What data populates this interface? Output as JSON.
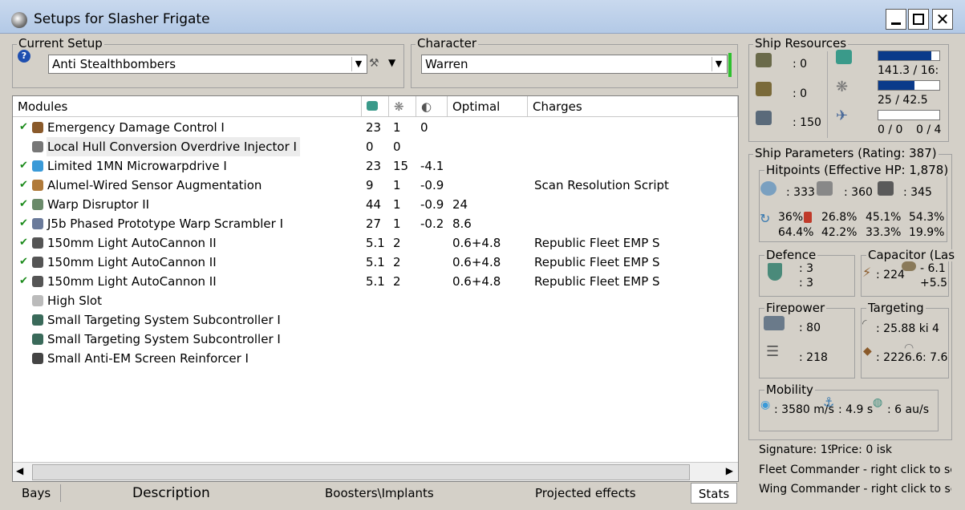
{
  "window": {
    "title": "Setups for Slasher Frigate"
  },
  "current_setup": {
    "legend": "Current Setup",
    "value": "Anti Stealthbombers"
  },
  "character": {
    "legend": "Character",
    "value": "Warren"
  },
  "modules": {
    "headers": [
      "Modules",
      "",
      "",
      "",
      "Optimal",
      "Charges"
    ],
    "rows": [
      {
        "checked": true,
        "name": "Emergency Damage Control I",
        "c1": "23",
        "c2": "1",
        "c3": "0",
        "optimal": "",
        "charges": "",
        "icon_color": "#8a5a2b"
      },
      {
        "checked": false,
        "name": "Local Hull Conversion Overdrive Injector I",
        "c1": "0",
        "c2": "0",
        "c3": "",
        "optimal": "",
        "charges": "",
        "icon_color": "#777777"
      },
      {
        "checked": true,
        "name": "Limited 1MN Microwarpdrive I",
        "c1": "23",
        "c2": "15",
        "c3": "-4.1",
        "optimal": "",
        "charges": "",
        "icon_color": "#3a9ad8"
      },
      {
        "checked": true,
        "name": "Alumel-Wired Sensor Augmentation",
        "c1": "9",
        "c2": "1",
        "c3": "-0.9",
        "optimal": "",
        "charges": "Scan Resolution Script",
        "icon_color": "#b07a3a"
      },
      {
        "checked": true,
        "name": "Warp Disruptor II",
        "c1": "44",
        "c2": "1",
        "c3": "-0.9",
        "optimal": "24",
        "charges": "",
        "icon_color": "#6a8a6a"
      },
      {
        "checked": true,
        "name": "J5b Phased Prototype Warp Scrambler I",
        "c1": "27",
        "c2": "1",
        "c3": "-0.2",
        "optimal": "8.6",
        "charges": "",
        "icon_color": "#6a7a9a"
      },
      {
        "checked": true,
        "name": "150mm Light AutoCannon II",
        "c1": "5.1",
        "c2": "2",
        "c3": "",
        "optimal": "0.6+4.8",
        "charges": "Republic Fleet EMP S",
        "icon_color": "#555555"
      },
      {
        "checked": true,
        "name": "150mm Light AutoCannon II",
        "c1": "5.1",
        "c2": "2",
        "c3": "",
        "optimal": "0.6+4.8",
        "charges": "Republic Fleet EMP S",
        "icon_color": "#555555"
      },
      {
        "checked": true,
        "name": "150mm Light AutoCannon II",
        "c1": "5.1",
        "c2": "2",
        "c3": "",
        "optimal": "0.6+4.8",
        "charges": "Republic Fleet EMP S",
        "icon_color": "#555555"
      },
      {
        "checked": false,
        "name": "High Slot",
        "c1": "",
        "c2": "",
        "c3": "",
        "optimal": "",
        "charges": "",
        "icon_color": "#bbbbbb"
      },
      {
        "checked": false,
        "name": "Small Targeting System Subcontroller I",
        "c1": "",
        "c2": "",
        "c3": "",
        "optimal": "",
        "charges": "",
        "icon_color": "#3a6a5a"
      },
      {
        "checked": false,
        "name": "Small Targeting System Subcontroller I",
        "c1": "",
        "c2": "",
        "c3": "",
        "optimal": "",
        "charges": "",
        "icon_color": "#3a6a5a"
      },
      {
        "checked": false,
        "name": "Small Anti-EM Screen Reinforcer I",
        "c1": "",
        "c2": "",
        "c3": "",
        "optimal": "",
        "charges": "",
        "icon_color": "#444444"
      }
    ]
  },
  "tabs": [
    "Bays",
    "Description",
    "Boosters\\Implants",
    "Projected effects",
    "Stats"
  ],
  "ship_resources": {
    "legend": "Ship Resources",
    "slots": [
      ": 0",
      ": 0",
      ": 150"
    ],
    "cpu": "141.3 / 16:",
    "cpu_fraction": 0.87,
    "power": "25 / 42.5",
    "power_fraction": 0.59,
    "drones": "0 / 0",
    "drones_bw": "0 / 4"
  },
  "ship_parameters": {
    "legend": "Ship Parameters (Rating: 387)",
    "hitpoints": {
      "legend": "Hitpoints (Effective HP: 1,878)",
      "shield": ": 333",
      "armor": ": 360",
      "structure": ": 345",
      "resists_top": [
        "36%",
        "26.8%",
        "45.1%",
        "54.3%"
      ],
      "resists_bottom": [
        "64.4%",
        "42.2%",
        "33.3%",
        "19.9%"
      ]
    },
    "defence": {
      "legend": "Defence",
      "v1": ": 3",
      "v2": ": 3"
    },
    "capacitor": {
      "legend": "Capacitor (Las",
      "v1": ": 224",
      "v2": "- 6.1",
      "v3": "+5.5"
    },
    "firepower": {
      "legend": "Firepower",
      "v1": ": 80",
      "v2": ": 218"
    },
    "targeting": {
      "legend": "Targeting",
      "v1": ": 25.88 ki",
      "v2": "4",
      "v3": ": 2226.6",
      "v4": ": 7.6"
    },
    "mobility": {
      "legend": "Mobility",
      "v1": ": 3580 m/s",
      "v2": ": 4.9 s",
      "v3": ": 6 au/s"
    },
    "signature": "Signature: 19",
    "price": "Price: 0 isk",
    "fleet_commander": "Fleet Commander - right click to se",
    "wing_commander": "Wing Commander - right click to se"
  }
}
